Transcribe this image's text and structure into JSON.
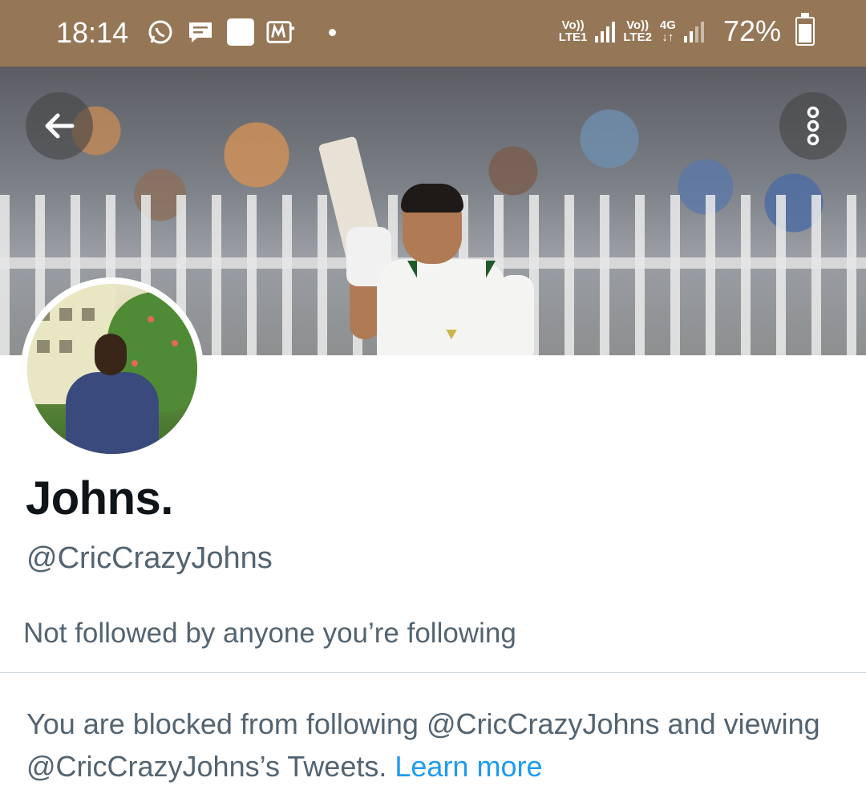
{
  "status_bar": {
    "time": "18:14",
    "sim1_label_top": "Vo))",
    "sim1_label_bottom": "LTE1",
    "sim2_label_top": "Vo))",
    "sim2_label_bottom": "LTE2",
    "network_type": "4G",
    "battery_percent": "72%",
    "battery_level": 0.72,
    "notification_icons": [
      "whatsapp-icon",
      "message-icon",
      "app-square-icon",
      "mi-icon"
    ]
  },
  "header": {
    "back_icon": "arrow-left-icon",
    "more_icon": "more-vertical-icon"
  },
  "profile": {
    "display_name": "Johns.",
    "handle": "@CricCrazyJohns",
    "followed_by": "Not followed by anyone you’re following"
  },
  "blocked_notice": {
    "message": "You are blocked from following @CricCrazyJohns and viewing @CricCrazyJohns’s Tweets.",
    "link_text": "Learn more"
  },
  "colors": {
    "status_bar_bg": "#957656",
    "primary_text": "#0f1419",
    "secondary_text": "#536471",
    "link": "#1d9bf0"
  }
}
